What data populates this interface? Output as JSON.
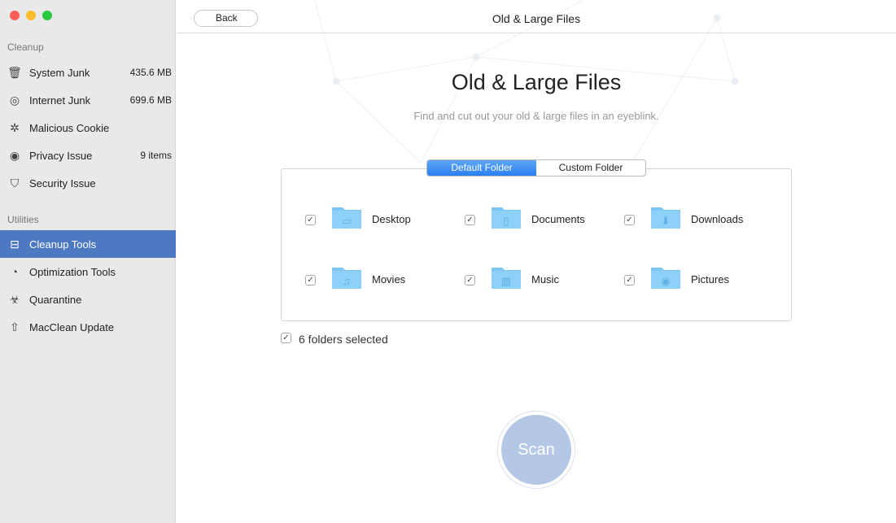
{
  "window": {
    "title": "Old & Large Files",
    "back_label": "Back"
  },
  "sidebar": {
    "cleanup_label": "Cleanup",
    "cleanup_items": [
      {
        "label": "System Junk",
        "value": "435.6 MB",
        "icon": "trash-icon"
      },
      {
        "label": "Internet Junk",
        "value": "699.6 MB",
        "icon": "compass-icon"
      },
      {
        "label": "Malicious Cookie",
        "value": "",
        "icon": "bug-icon"
      },
      {
        "label": "Privacy Issue",
        "value": "9 items",
        "icon": "eye-icon"
      },
      {
        "label": "Security Issue",
        "value": "",
        "icon": "shield-icon"
      }
    ],
    "utilities_label": "Utilities",
    "utility_items": [
      {
        "label": "Cleanup Tools",
        "icon": "toolbox-icon",
        "selected": true
      },
      {
        "label": "Optimization Tools",
        "icon": "gauge-icon"
      },
      {
        "label": "Quarantine",
        "icon": "biohazard-icon"
      },
      {
        "label": "MacClean Update",
        "icon": "arrow-up-icon"
      }
    ]
  },
  "main": {
    "heading": "Old & Large Files",
    "subtitle": "Find and cut out your old & large files in an eyeblink.",
    "tabs": [
      {
        "label": "Default Folder",
        "active": true
      },
      {
        "label": "Custom Folder",
        "active": false
      }
    ],
    "folders": [
      {
        "label": "Desktop",
        "checked": true,
        "glyph": "▭"
      },
      {
        "label": "Documents",
        "checked": true,
        "glyph": "▯"
      },
      {
        "label": "Downloads",
        "checked": true,
        "glyph": "⬇"
      },
      {
        "label": "Movies",
        "checked": true,
        "glyph": "♫"
      },
      {
        "label": "Music",
        "checked": true,
        "glyph": "▥"
      },
      {
        "label": "Pictures",
        "checked": true,
        "glyph": "◉"
      }
    ],
    "selected_count_label": "6 folders selected",
    "scan_label": "Scan"
  },
  "colors": {
    "accent": "#4c79c2",
    "folder": "#7cc6f5",
    "scan": "#b4c8e6"
  }
}
